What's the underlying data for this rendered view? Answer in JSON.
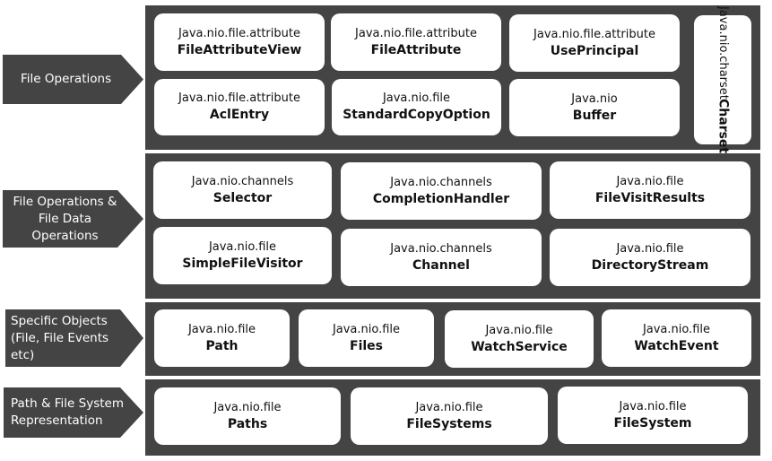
{
  "rows": [
    {
      "label": "File Operations",
      "cards": [
        {
          "package": "Java.nio.file.attribute",
          "class": "FileAttributeView"
        },
        {
          "package": "Java.nio.file.attribute",
          "class": "FileAttribute"
        },
        {
          "package": "Java.nio.file.attribute",
          "class": "UsePrincipal"
        },
        {
          "package": "Java.nio.file.attribute",
          "class": "AclEntry"
        },
        {
          "package": "Java.nio.file",
          "class": "StandardCopyOption"
        },
        {
          "package": "Java.nio",
          "class": "Buffer"
        },
        {
          "package": "Java.nio.charset",
          "class": "Charset"
        }
      ]
    },
    {
      "label": "File Operations &\nFile Data\nOperations",
      "cards": [
        {
          "package": "Java.nio.channels",
          "class": "Selector"
        },
        {
          "package": "Java.nio.channels",
          "class": "CompletionHandler"
        },
        {
          "package": "Java.nio.file",
          "class": "FileVisitResults"
        },
        {
          "package": "Java.nio.file",
          "class": "SimpleFileVisitor"
        },
        {
          "package": "Java.nio.channels",
          "class": "Channel"
        },
        {
          "package": "Java.nio.file",
          "class": "DirectoryStream"
        }
      ]
    },
    {
      "label": "Specific Objects\n(File, File Events\netc)",
      "cards": [
        {
          "package": "Java.nio.file",
          "class": "Path"
        },
        {
          "package": "Java.nio.file",
          "class": "Files"
        },
        {
          "package": "Java.nio.file",
          "class": "WatchService"
        },
        {
          "package": "Java.nio.file",
          "class": "WatchEvent"
        }
      ]
    },
    {
      "label": "Path & File System\nRepresentation",
      "cards": [
        {
          "package": "Java.nio.file",
          "class": "Paths"
        },
        {
          "package": "Java.nio.file",
          "class": "FileSystems"
        },
        {
          "package": "Java.nio.file",
          "class": "FileSystem"
        }
      ]
    }
  ]
}
